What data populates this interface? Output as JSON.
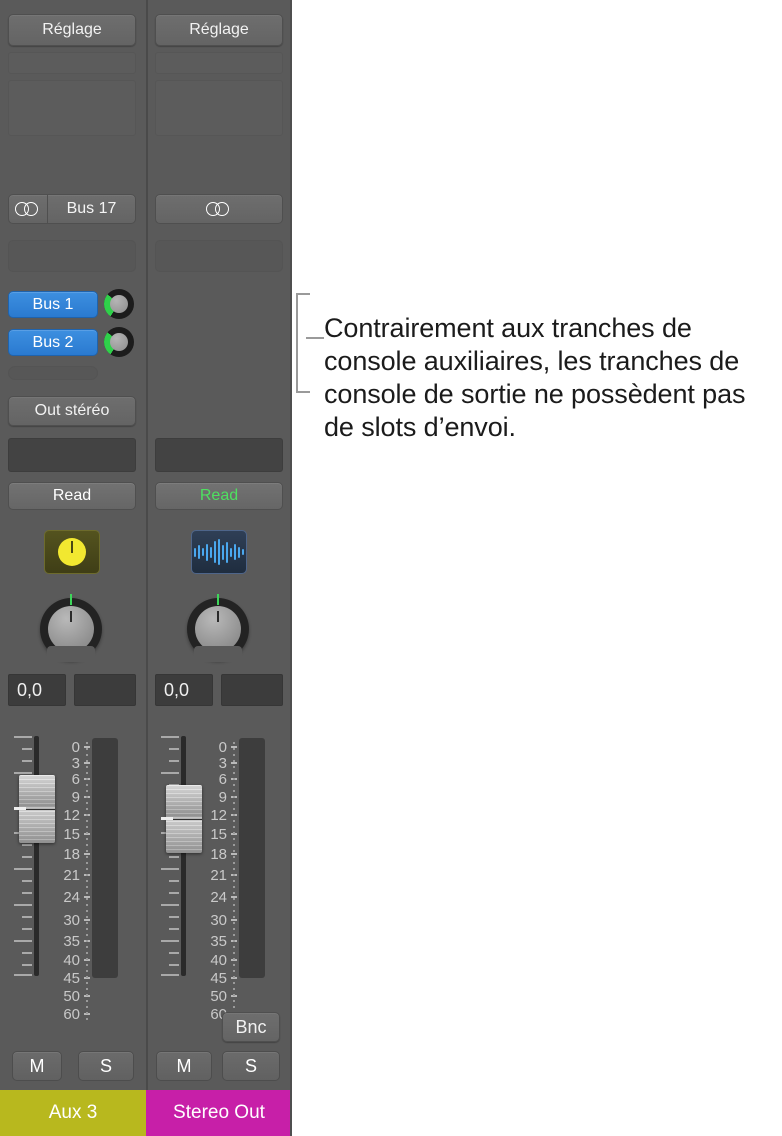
{
  "panel": {
    "background_color": "#5a5a5a"
  },
  "callout": {
    "text": "Contrairement aux tranches de console auxiliaires, les tranches de console de sortie ne possèdent pas de slots d’envoi.",
    "bracket_color": "#9a9a9a",
    "text_color": "#1b1b1b"
  },
  "strips": [
    {
      "id": "aux-3",
      "setting_button": "Réglage",
      "input_label": "Bus 17",
      "input_icon": "stereo-circles-icon",
      "sends": [
        {
          "label": "Bus 1",
          "knob": "send-level-knob"
        },
        {
          "label": "Bus 2",
          "knob": "send-level-knob"
        }
      ],
      "output_label": "Out stéréo",
      "automation_mode": "Read",
      "automation_color": "#ffffff",
      "insert_icon": "eq-knob-icon",
      "pan_value": "0,0",
      "level_value": "",
      "mute_label": "M",
      "solo_label": "S",
      "bounce_label": null,
      "name": "Aux 3",
      "name_color": "#b8b81e",
      "scale_labels": [
        "0",
        "3",
        "6",
        "9",
        "12",
        "15",
        "18",
        "21",
        "24",
        "30",
        "35",
        "40",
        "45",
        "50",
        "60"
      ]
    },
    {
      "id": "stereo-out",
      "setting_button": "Réglage",
      "input_label": "",
      "input_icon": "stereo-circles-icon",
      "sends": [],
      "output_label": null,
      "automation_mode": "Read",
      "automation_color": "#4ee060",
      "insert_icon": "waveform-icon",
      "pan_value": "0,0",
      "level_value": "",
      "mute_label": "M",
      "solo_label": "S",
      "bounce_label": "Bnc",
      "name": "Stereo Out",
      "name_color": "#c71fa8",
      "scale_labels": [
        "0",
        "3",
        "6",
        "9",
        "12",
        "15",
        "18",
        "21",
        "24",
        "30",
        "35",
        "40",
        "45",
        "50",
        "60"
      ]
    }
  ]
}
